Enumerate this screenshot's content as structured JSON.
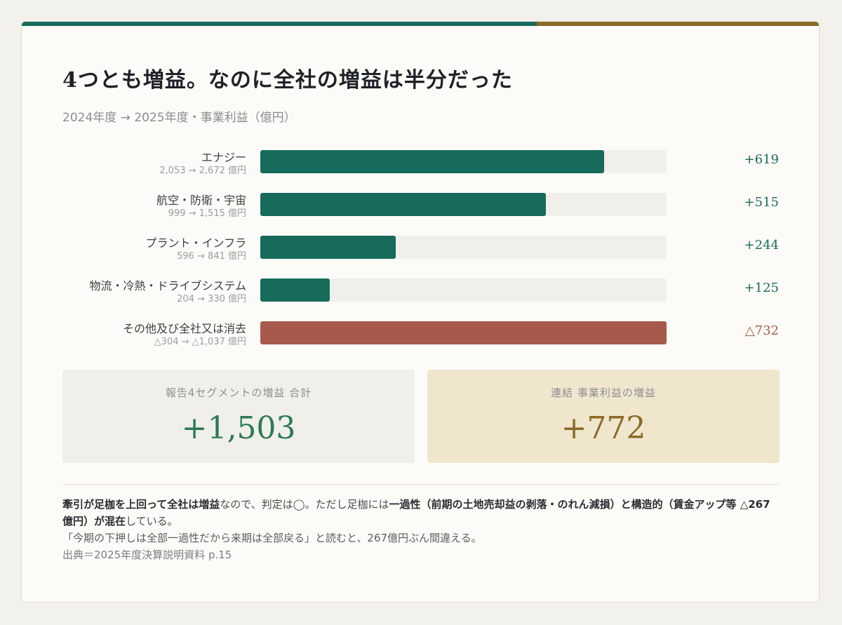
{
  "title": "4つとも増益。なのに全社の増益は半分だった",
  "subtitle": "2024年度 → 2025年度・事業利益（億円）",
  "colors": {
    "positive": "#176b5b",
    "negative": "#a75a4b",
    "gold": "#8a6a26"
  },
  "chart_data": {
    "type": "bar",
    "orientation": "horizontal",
    "unit": "億円",
    "categories": [
      "エナジー",
      "航空・防衛・宇宙",
      "プラント・インフラ",
      "物流・冷熱・ドライブシステム",
      "その他及び全社又は消去"
    ],
    "values": [
      619,
      515,
      244,
      125,
      -732
    ],
    "value_labels": [
      "+619",
      "+515",
      "+244",
      "+125",
      "△732"
    ],
    "details": [
      "2,053 → 2,672 億円",
      "999 → 1,515 億円",
      "596 → 841 億円",
      "204 → 330 億円",
      "△304 → △1,037 億円"
    ],
    "xlim": [
      0,
      732
    ]
  },
  "summary": {
    "segments_label": "報告4セグメントの増益 合計",
    "segments_value": "+1,503",
    "consolidated_label": "連結 事業利益の増益",
    "consolidated_value": "+772"
  },
  "notes": {
    "p1_b1": "牽引が足枷を上回って全社は増益",
    "p1_t1": "なので、判定は◯。ただし足枷には",
    "p1_b2": "一過性（前期の土地売却益の剥落・のれん減損）と構造的（賃金アップ等 △267億円）が混在",
    "p1_t2": "している。",
    "line2": "「今期の下押しは全部一過性だから来期は全部戻る」と読むと、267億円ぶん間違える。",
    "source": "出典＝2025年度決算説明資料 p.15"
  }
}
